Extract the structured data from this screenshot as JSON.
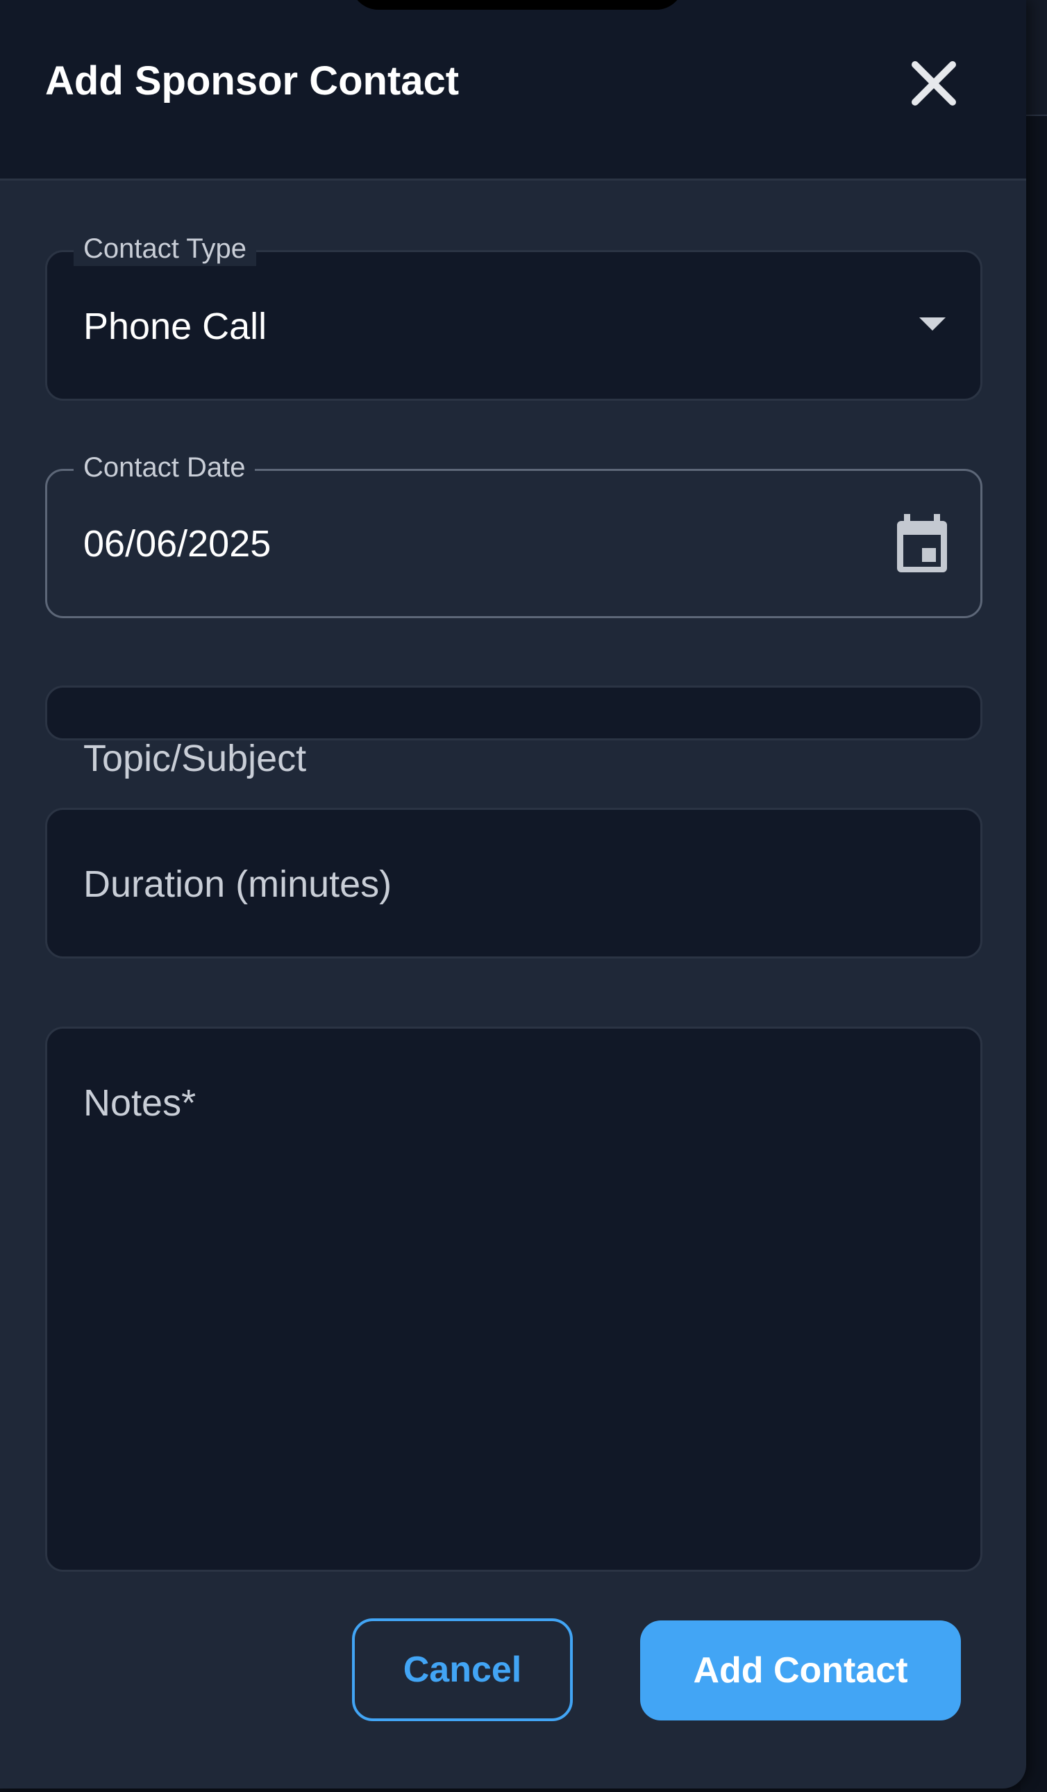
{
  "dialog": {
    "title": "Add Sponsor Contact",
    "close_icon": "close-icon"
  },
  "form": {
    "contact_type": {
      "label": "Contact Type",
      "value": "Phone Call",
      "icon": "chevron-down-icon"
    },
    "contact_date": {
      "label": "Contact Date",
      "value": "06/06/2025",
      "icon": "calendar-icon"
    },
    "topic": {
      "placeholder": "Topic/Subject"
    },
    "duration": {
      "placeholder": "Duration (minutes)"
    },
    "notes": {
      "placeholder": "Notes*"
    }
  },
  "actions": {
    "cancel_label": "Cancel",
    "submit_label": "Add Contact"
  },
  "colors": {
    "accent": "#42a5f5",
    "dialog_bg": "#1f2838",
    "field_bg": "#111827",
    "header_bg": "#111827",
    "text": "#ffffff",
    "muted_text": "#c9ced7"
  }
}
